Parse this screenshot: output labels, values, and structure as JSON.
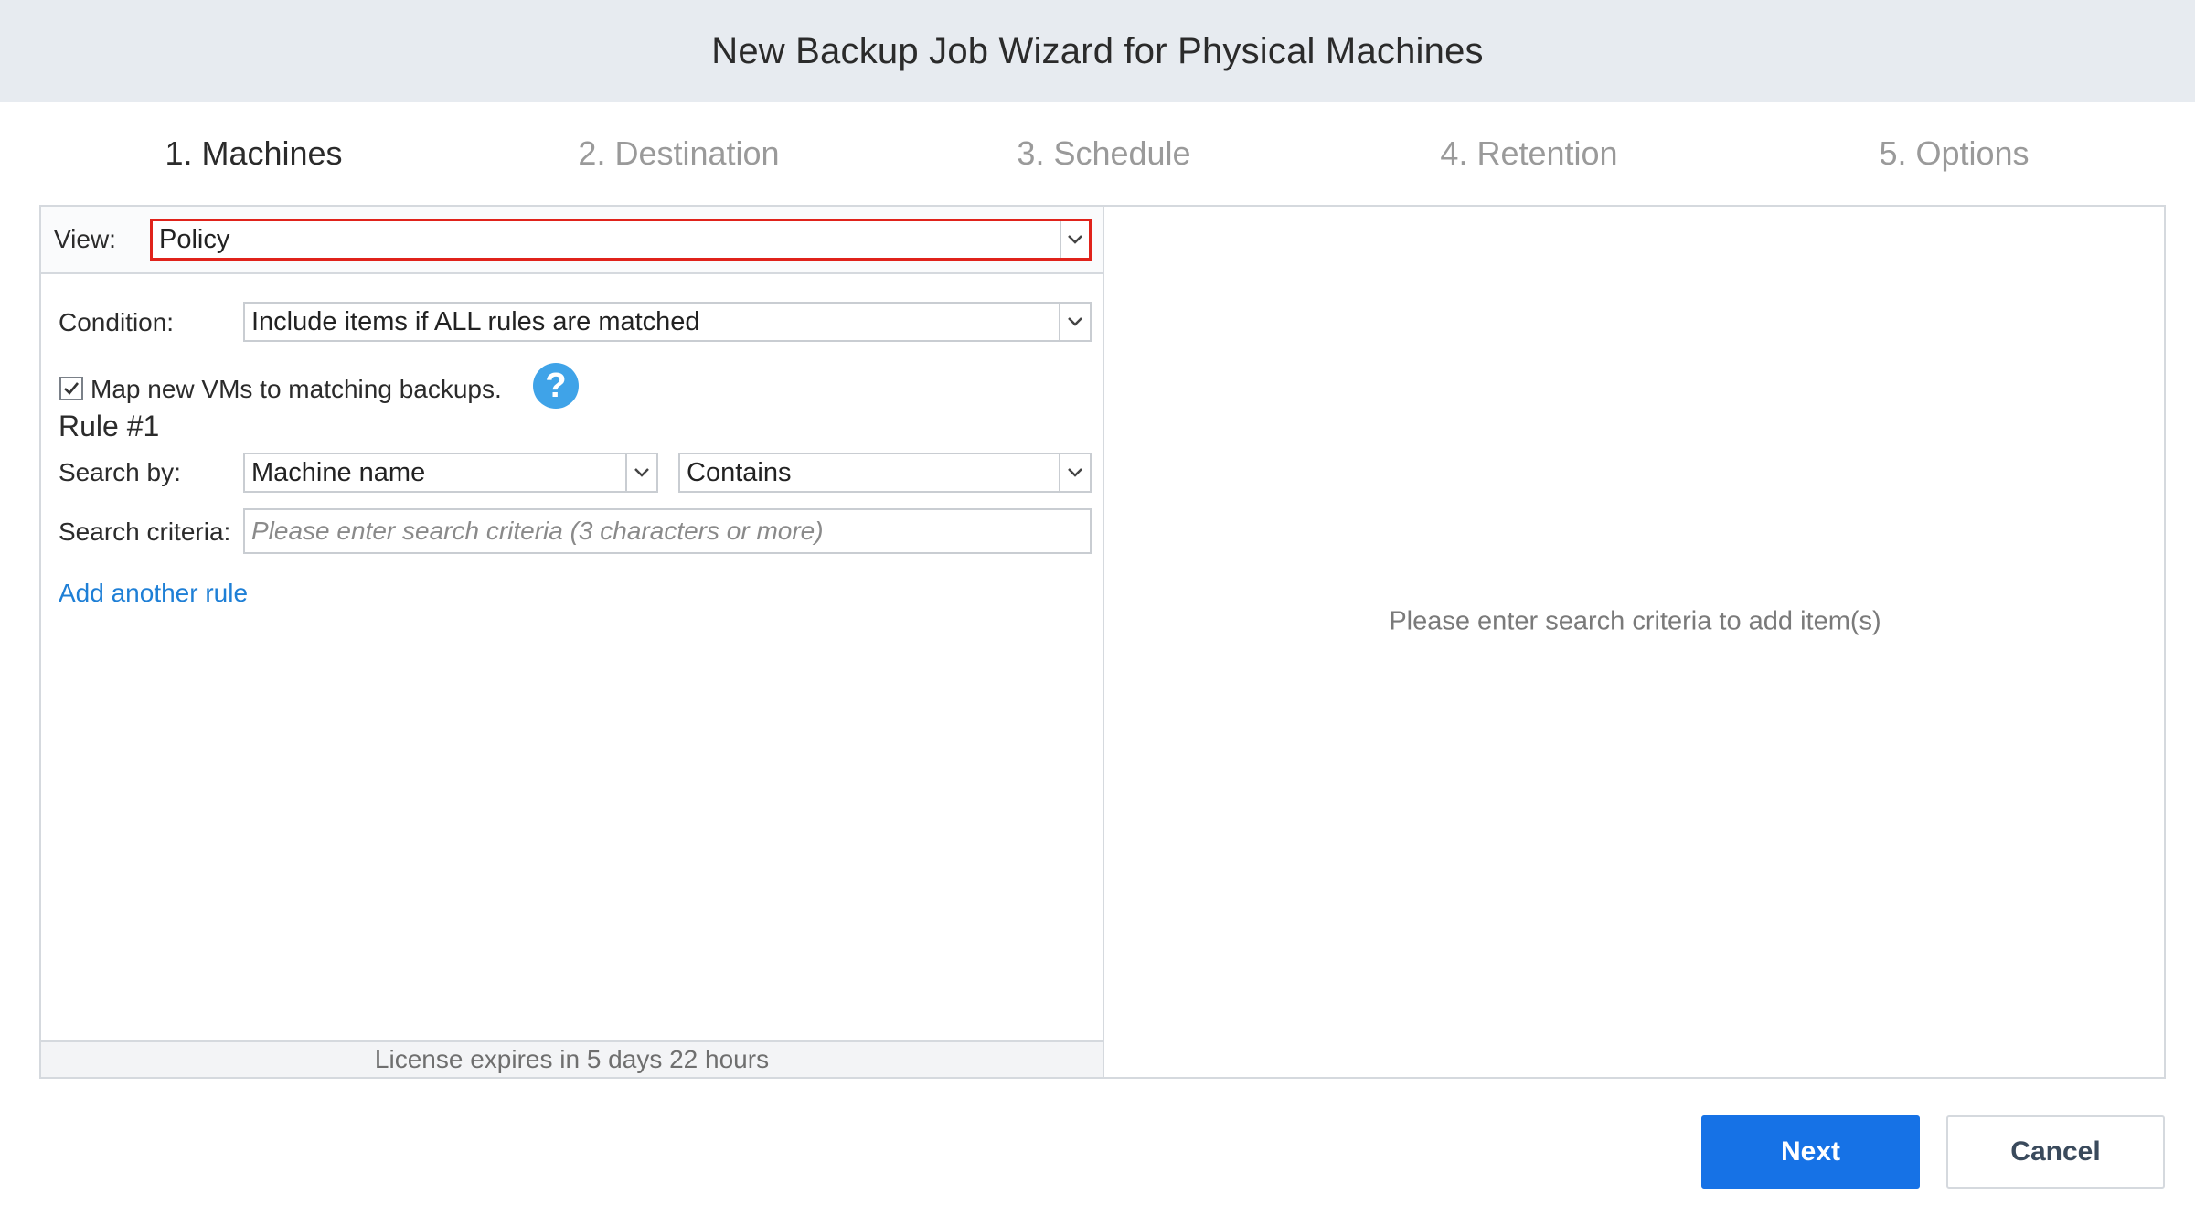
{
  "window": {
    "title": "New Backup Job Wizard for Physical Machines"
  },
  "steps": [
    {
      "label": "1. Machines",
      "active": true
    },
    {
      "label": "2. Destination",
      "active": false
    },
    {
      "label": "3. Schedule",
      "active": false
    },
    {
      "label": "4. Retention",
      "active": false
    },
    {
      "label": "5. Options",
      "active": false
    }
  ],
  "view": {
    "label": "View:",
    "value": "Policy"
  },
  "condition": {
    "label": "Condition:",
    "value": "Include items if ALL rules are matched"
  },
  "map_vms": {
    "label": "Map new VMs to matching backups.",
    "checked": true
  },
  "help_icon": {
    "icon": "question-circle-icon",
    "glyph": "?",
    "color": "#3fa3e8"
  },
  "rule": {
    "title": "Rule #1",
    "search_by_label": "Search by:",
    "search_by_value": "Machine name",
    "operator_value": "Contains",
    "criteria_label": "Search criteria:",
    "criteria_placeholder": "Please enter search criteria (3 characters or more)",
    "criteria_value": ""
  },
  "add_rule_link": "Add another rule",
  "license": "License expires in 5 days 22 hours",
  "results": {
    "empty_message": "Please enter search criteria to add item(s)"
  },
  "buttons": {
    "next": "Next",
    "cancel": "Cancel"
  },
  "colors": {
    "accent": "#1672e6",
    "highlight": "#e0231b",
    "link": "#1e7fd6"
  }
}
